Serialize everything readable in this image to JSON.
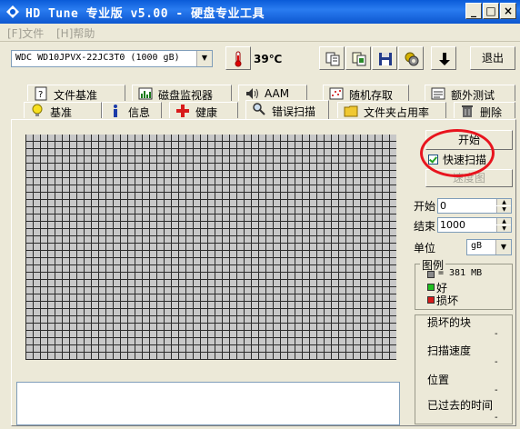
{
  "window": {
    "title": "HD Tune 专业版 v5.00 - 硬盘专业工具",
    "min": "_",
    "max": "□",
    "close": "×"
  },
  "menu": {
    "file": "[F]文件",
    "help": "[H]帮助"
  },
  "toolbar": {
    "drive": "WDC WD10JPVX-22JC3T0 (1000 gB)",
    "temperature": "39℃",
    "exit": "退出"
  },
  "tabs_top": [
    {
      "label": "文件基准",
      "icon": "file-benchmark-icon"
    },
    {
      "label": "磁盘监视器",
      "icon": "disk-monitor-icon"
    },
    {
      "label": "AAM",
      "icon": "speaker-icon"
    },
    {
      "label": "随机存取",
      "icon": "random-access-icon"
    },
    {
      "label": "额外测试",
      "icon": "extra-tests-icon"
    }
  ],
  "tabs_bottom": [
    {
      "label": "基准",
      "icon": "lightbulb-icon"
    },
    {
      "label": "信息",
      "icon": "info-icon"
    },
    {
      "label": "健康",
      "icon": "health-cross-icon"
    },
    {
      "label": "错误扫描",
      "icon": "magnifier-icon",
      "active": true
    },
    {
      "label": "文件夹占用率",
      "icon": "folder-icon"
    },
    {
      "label": "删除",
      "icon": "trash-icon"
    }
  ],
  "scan": {
    "start_button": "开始",
    "quick_scan_label": "快速扫描",
    "quick_scan_checked": true,
    "speed_map_button": "速度图",
    "start_label": "开始",
    "start_value": "0",
    "end_label": "结束",
    "end_value": "1000",
    "unit_label": "单位",
    "unit_value": "gB",
    "legend_title": "图例",
    "legend_block": "= 381 MB",
    "legend_good": "好",
    "legend_bad": "损坏",
    "stats": [
      {
        "label": "损坏的块",
        "value": "-"
      },
      {
        "label": "扫描速度",
        "value": "-"
      },
      {
        "label": "位置",
        "value": "-"
      },
      {
        "label": "已过去的时间",
        "value": "-"
      }
    ]
  },
  "colors": {
    "titlebar": "#0A5BD8",
    "good": "#1fbf1f",
    "bad": "#d81a1a",
    "block": "#8a8a8a",
    "highlight": "#e8141e"
  }
}
